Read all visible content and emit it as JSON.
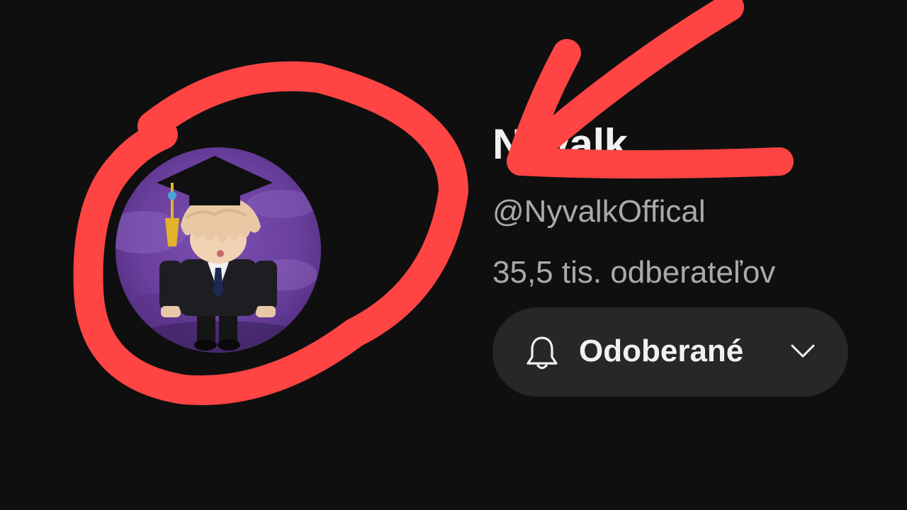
{
  "channel": {
    "name": "Nyvalk",
    "handle": "@NyvalkOffical",
    "subscribers": "35,5 tis. odberateľov"
  },
  "subscribe": {
    "label": "Odoberané",
    "icon": "bell-icon",
    "dropdown_icon": "chevron-down-icon"
  },
  "colors": {
    "background": "#0f0f0f",
    "button_bg": "#272727",
    "annotation": "#ff4444"
  }
}
